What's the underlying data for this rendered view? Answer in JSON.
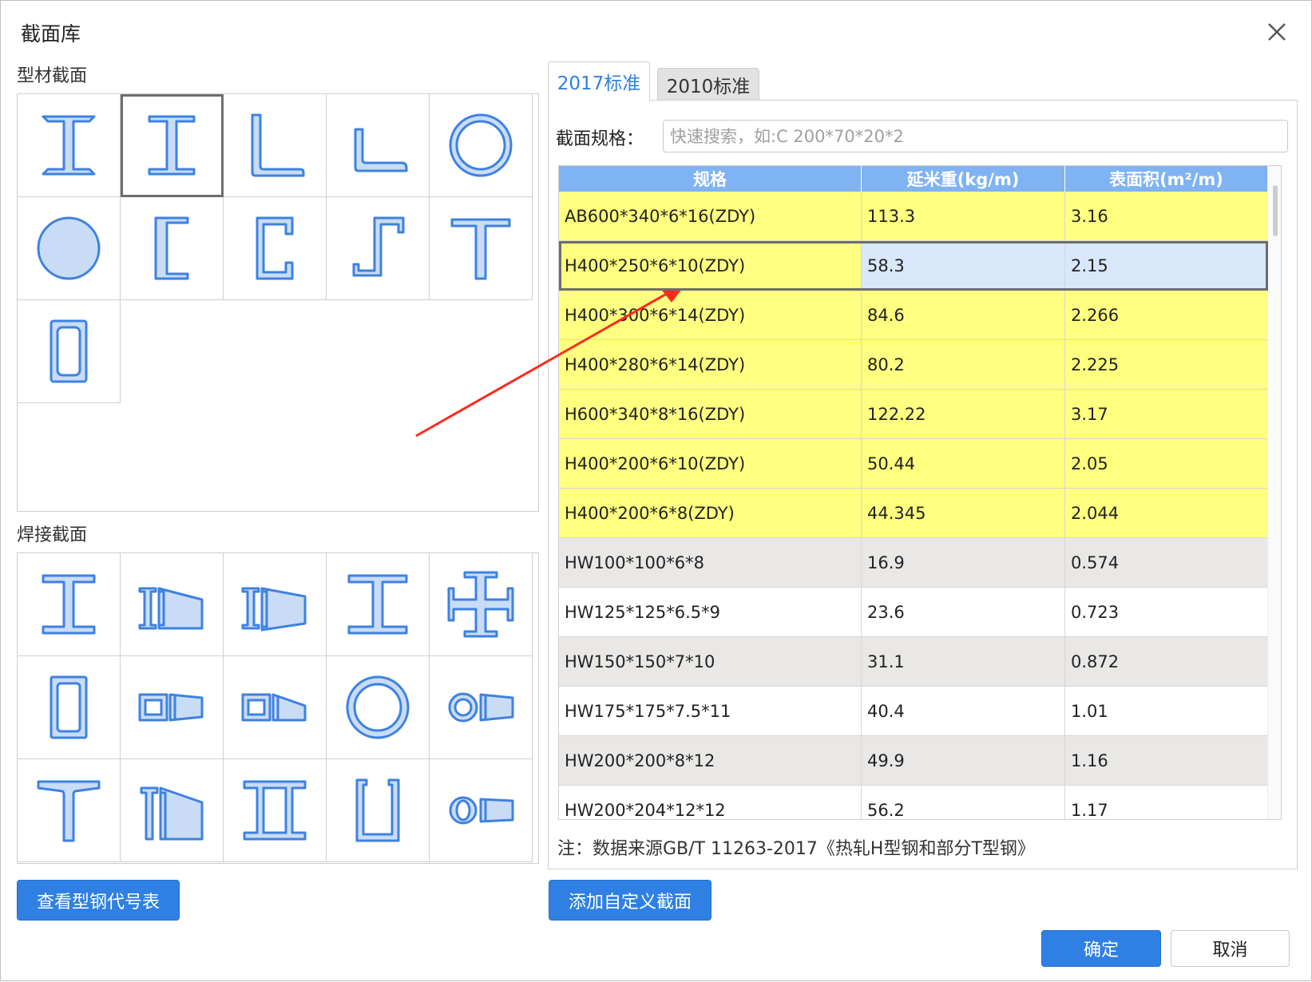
{
  "dialog": {
    "title": "截面库"
  },
  "profile_section": {
    "label": "型材截面",
    "cells": [
      "i-beam-icon",
      "i-beam-selected-icon",
      "angle-icon",
      "unequal-angle-icon",
      "pipe-icon",
      "solid-round-icon",
      "channel-icon",
      "lipped-channel-icon",
      "z-section-icon",
      "tee-icon",
      "rect-tube-icon"
    ]
  },
  "weld_section": {
    "label": "焊接截面",
    "cells": [
      "welded-i-icon",
      "tapered-i-icon",
      "double-tapered-i-icon",
      "welded-h-icon",
      "cross-h-icon",
      "welded-box-icon",
      "tapered-box-icon",
      "single-tapered-box-icon",
      "welded-pipe-icon",
      "tapered-pipe-icon",
      "welded-tee-icon",
      "tapered-tee-icon",
      "double-i-icon",
      "u-section-icon",
      "tapered-pipe-2-icon"
    ]
  },
  "tabs": [
    {
      "label": "2017标准"
    },
    {
      "label": "2010标准"
    }
  ],
  "search": {
    "label": "截面规格：",
    "placeholder": "快速搜索，如:C 200*70*20*2"
  },
  "table": {
    "columns": [
      "规格",
      "延米重(kg/m)",
      "表面积(m²/m)"
    ],
    "rows": [
      {
        "spec": "AB600*340*6*16(ZDY)",
        "weight": "113.3",
        "area": "3.16",
        "style": "yellow"
      },
      {
        "spec": "H400*250*6*10(ZDY)",
        "weight": "58.3",
        "area": "2.15",
        "style": "yellow",
        "selected": true
      },
      {
        "spec": "H400*300*6*14(ZDY)",
        "weight": "84.6",
        "area": "2.266",
        "style": "yellow"
      },
      {
        "spec": "H400*280*6*14(ZDY)",
        "weight": "80.2",
        "area": "2.225",
        "style": "yellow"
      },
      {
        "spec": "H600*340*8*16(ZDY)",
        "weight": "122.22",
        "area": "3.17",
        "style": "yellow"
      },
      {
        "spec": "H400*200*6*10(ZDY)",
        "weight": "50.44",
        "area": "2.05",
        "style": "yellow"
      },
      {
        "spec": "H400*200*6*8(ZDY)",
        "weight": "44.345",
        "area": "2.044",
        "style": "yellow"
      },
      {
        "spec": "HW100*100*6*8",
        "weight": "16.9",
        "area": "0.574",
        "style": "gray"
      },
      {
        "spec": "HW125*125*6.5*9",
        "weight": "23.6",
        "area": "0.723",
        "style": "white"
      },
      {
        "spec": "HW150*150*7*10",
        "weight": "31.1",
        "area": "0.872",
        "style": "gray"
      },
      {
        "spec": "HW175*175*7.5*11",
        "weight": "40.4",
        "area": "1.01",
        "style": "white"
      },
      {
        "spec": "HW200*200*8*12",
        "weight": "49.9",
        "area": "1.16",
        "style": "gray"
      },
      {
        "spec": "HW200*204*12*12",
        "weight": "56.2",
        "area": "1.17",
        "style": "white"
      }
    ]
  },
  "note": "注：数据来源GB/T 11263-2017《热轧H型钢和部分T型钢》",
  "buttons": {
    "view_codes": "查看型钢代号表",
    "add_custom": "添加自定义截面",
    "ok": "确定",
    "cancel": "取消"
  },
  "colors": {
    "accent": "#2f80e2",
    "header": "#7fb3f3",
    "highlight_row": "#ffff80",
    "annotation_arrow": "#ff2a1a"
  }
}
